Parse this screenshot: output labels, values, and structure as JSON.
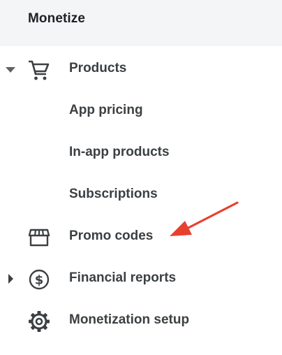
{
  "section": {
    "title": "Monetize"
  },
  "nav": {
    "products": {
      "label": "Products",
      "icon": "shopping-cart-icon",
      "expanded": true
    },
    "app_pricing": {
      "label": "App pricing"
    },
    "in_app_products": {
      "label": "In-app products"
    },
    "subscriptions": {
      "label": "Subscriptions"
    },
    "promo_codes": {
      "label": "Promo codes",
      "icon": "storefront-icon"
    },
    "financial_reports": {
      "label": "Financial reports",
      "icon": "dollar-circle-icon",
      "expanded": false
    },
    "monetization_setup": {
      "label": "Monetization setup",
      "icon": "gear-icon"
    }
  },
  "annotation": {
    "arrow_color": "#e8402f",
    "points_to": "Promo codes"
  },
  "colors": {
    "header_bg": "#f4f5f7",
    "text": "#3c4043",
    "title": "#202124"
  }
}
